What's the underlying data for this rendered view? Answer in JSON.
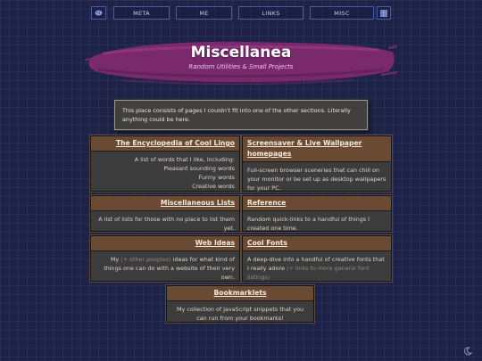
{
  "nav": {
    "items": [
      "META",
      "ME",
      "LINKS",
      "MISC"
    ],
    "left_icon": "cookie-icon",
    "right_icon": "book-icon"
  },
  "header": {
    "title": "Miscellanea",
    "subtitle": "Random Utilities & Small Projects"
  },
  "intro": {
    "text": "This place consists of pages I couldn't fit into one of the other sections. Literally anything could be here."
  },
  "cards": {
    "lingo": {
      "title": "The Encyclopedia of Cool Lingo",
      "desc": "A list of words that I like, including:",
      "items": [
        "Pleasant sounding words",
        "Funny words",
        "Creative words"
      ]
    },
    "screensaver": {
      "title": "Screensaver & Live Wallpaper homepages",
      "desc": "Full-screen browser sceneries that can chill on your monitor or be set up as desktop wallpapers for your PC."
    },
    "lists": {
      "title": "Miscellaneous Lists",
      "desc": "A list of lists for those with no place to list them yet."
    },
    "reference": {
      "title": "Reference",
      "desc": "Random quick-links to a handful of things I created one time."
    },
    "webideas": {
      "title": "Web Ideas",
      "desc_pre": "My",
      "desc_muted": "(+ other peoples)",
      "desc_post": "ideas for what kind of things one can do with a website of their very own."
    },
    "fonts": {
      "title": "Cool Fonts",
      "desc_pre": "A deep-dive into a handful of creative fonts that I really adore",
      "desc_muted": "(+ links to more general font listings)"
    },
    "bookmarklets": {
      "title": "Bookmarklets",
      "desc": "My collection of JavaScript snippets that you can run from your bookmarks!"
    }
  },
  "footer": {
    "corner_icon": "moon-icon"
  },
  "colors": {
    "background": "#1d2246",
    "card_header": "#6b4a33",
    "card_body": "#3c3c3c",
    "brush": "#7a2a6c",
    "subtitle": "#e8c6f2",
    "nav_border": "#4a5a9e"
  }
}
